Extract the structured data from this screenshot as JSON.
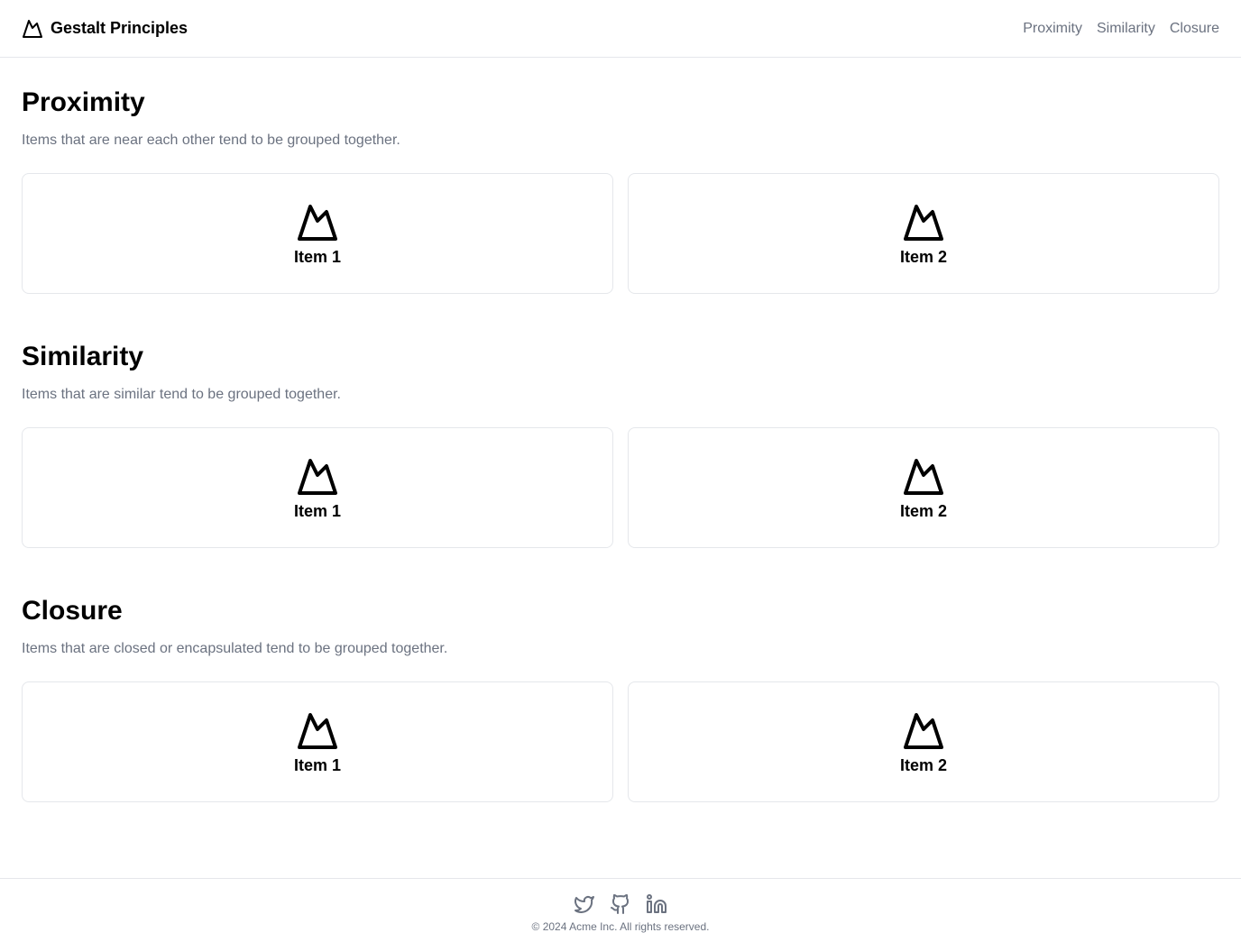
{
  "header": {
    "title": "Gestalt Principles",
    "nav": [
      "Proximity",
      "Similarity",
      "Closure"
    ]
  },
  "sections": [
    {
      "title": "Proximity",
      "description": "Items that are near each other tend to be grouped together.",
      "items": [
        "Item 1",
        "Item 2"
      ]
    },
    {
      "title": "Similarity",
      "description": "Items that are similar tend to be grouped together.",
      "items": [
        "Item 1",
        "Item 2"
      ]
    },
    {
      "title": "Closure",
      "description": "Items that are closed or encapsulated tend to be grouped together.",
      "items": [
        "Item 1",
        "Item 2"
      ]
    }
  ],
  "footer": {
    "copyright": "© 2024 Acme Inc. All rights reserved.",
    "social": [
      "twitter-icon",
      "github-icon",
      "linkedin-icon"
    ]
  }
}
